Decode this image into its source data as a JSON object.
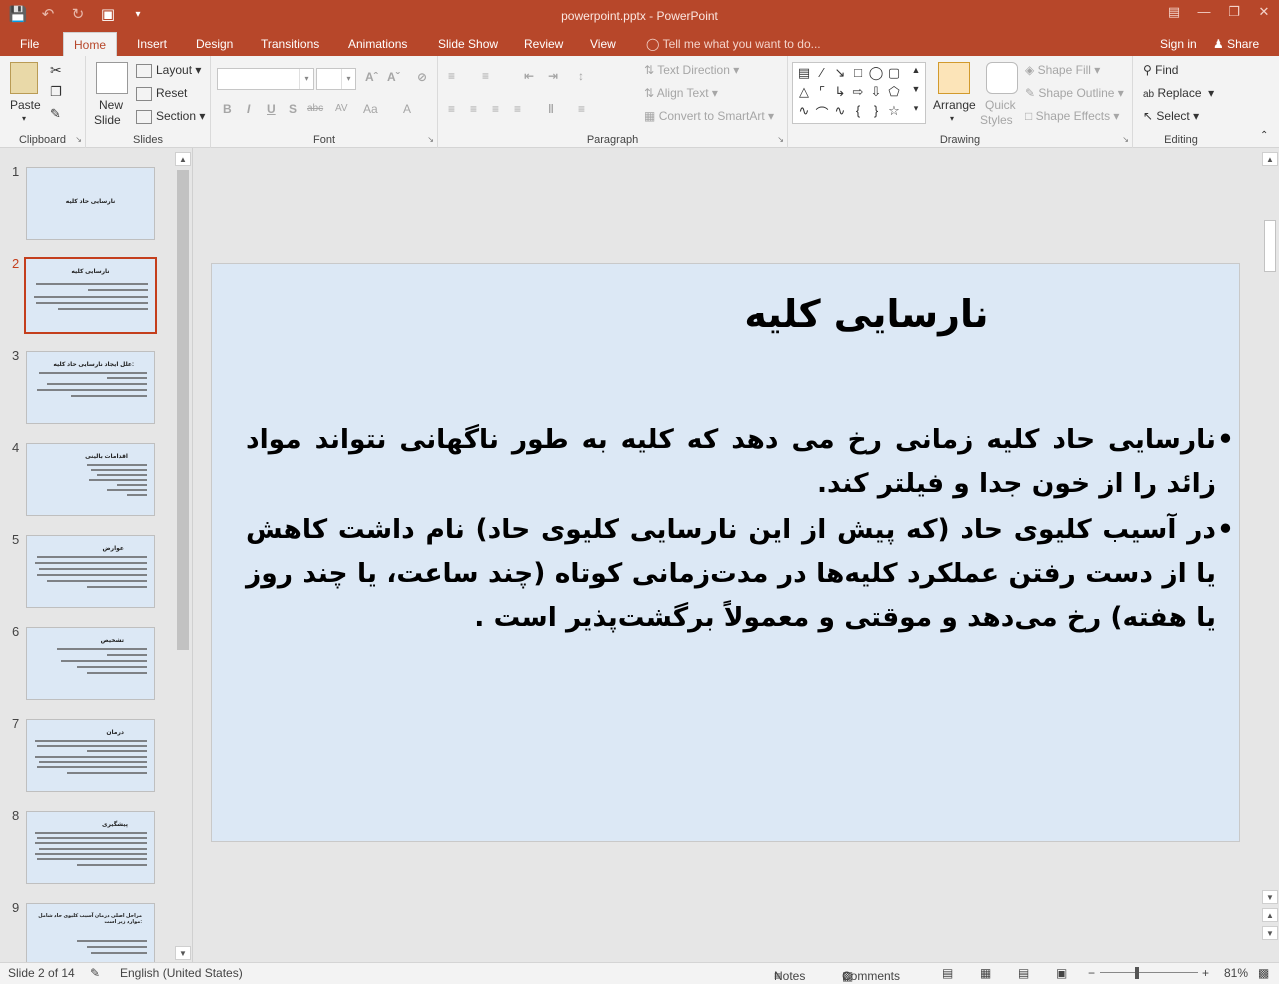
{
  "app": {
    "window_title": "powerpoint.pptx - PowerPoint",
    "accent_color": "#b7472a"
  },
  "tabs": [
    {
      "label": "File"
    },
    {
      "label": "Home",
      "active": true
    },
    {
      "label": "Insert"
    },
    {
      "label": "Design"
    },
    {
      "label": "Transitions"
    },
    {
      "label": "Animations"
    },
    {
      "label": "Slide Show"
    },
    {
      "label": "Review"
    },
    {
      "label": "View"
    }
  ],
  "tell_me": "Tell me what you want to do...",
  "sign_in": "Sign in",
  "share": "Share",
  "ribbon": {
    "clipboard": {
      "label": "Clipboard",
      "paste": "Paste"
    },
    "slides": {
      "label": "Slides",
      "new_slide_1": "New",
      "new_slide_2": "Slide",
      "layout": "Layout",
      "reset": "Reset",
      "section": "Section"
    },
    "font": {
      "label": "Font",
      "bold": "B",
      "italic": "I",
      "underline": "U",
      "shadow": "S",
      "strike": "abc",
      "spacing": "AV",
      "case": "Aa"
    },
    "paragraph": {
      "label": "Paragraph",
      "text_direction": "Text Direction",
      "align_text": "Align Text",
      "smartart": "Convert to SmartArt"
    },
    "drawing": {
      "label": "Drawing",
      "arrange": "Arrange",
      "quick_styles_1": "Quick",
      "quick_styles_2": "Styles",
      "shape_fill": "Shape Fill",
      "shape_outline": "Shape Outline",
      "shape_effects": "Shape Effects"
    },
    "editing": {
      "label": "Editing",
      "find": "Find",
      "replace": "Replace",
      "select": "Select"
    }
  },
  "thumbnails": [
    {
      "num": "1",
      "title": "نارسایی حاد کلیه"
    },
    {
      "num": "2",
      "title": "نارسایی کلیه",
      "selected": true
    },
    {
      "num": "3",
      "title": "علل ایجاد نارسایی حاد کلیه:"
    },
    {
      "num": "4",
      "title": "اقدامات بالینی"
    },
    {
      "num": "5",
      "title": "عوارض"
    },
    {
      "num": "6",
      "title": "تشخیص"
    },
    {
      "num": "7",
      "title": "درمان"
    },
    {
      "num": "8",
      "title": "پیشگیری"
    },
    {
      "num": "9",
      "title": "مراحل اصلی درمان آسیب کلیوی حاد شامل موارد زیر است:"
    }
  ],
  "slide": {
    "title": "نارسایی کلیه",
    "bullets": [
      "نارسایی حاد کلیه زمانی رخ می دهد که کلیه به طور ناگهانی نتواند مواد زائد را از خون جدا و فیلتر کند.",
      "در آسیب کلیوی حاد (که پیش از این نارسایی کلیوی حاد) نام داشت کاهش یا از دست رفتن عملکرد کلیه‌ها در مدت‌زمانی کوتاه (چند ساعت، یا چند روز یا هفته) رخ می‌دهد و موقتی و معمولاً برگشت‌پذیر است ."
    ]
  },
  "status": {
    "slide_count": "Slide 2 of 14",
    "language": "English (United States)",
    "notes": "Notes",
    "comments": "Comments",
    "zoom": "81%"
  }
}
